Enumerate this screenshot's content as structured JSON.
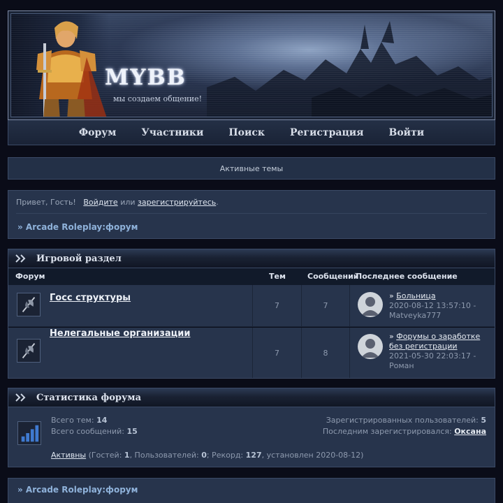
{
  "banner": {
    "title": "MYBB",
    "slogan": "мы создаем общение!"
  },
  "nav": {
    "items": [
      "Форум",
      "Участники",
      "Поиск",
      "Регистрация",
      "Войти"
    ]
  },
  "active_topics": "Активные темы",
  "welcome": {
    "greeting": "Привет, Гость!",
    "login_link": "Войдите",
    "or": "или",
    "register_link": "зарегистрируйтесь",
    "period": "."
  },
  "breadcrumb": "» Arcade Roleplay:форум",
  "game_section": {
    "title": "Игровой раздел",
    "columns": {
      "forum": "Форум",
      "topics": "Тем",
      "posts": "Сообщений",
      "last_post": "Последнее сообщение"
    },
    "forums": [
      {
        "name": "Госс структуры",
        "topics": "7",
        "posts": "7",
        "last_title": "Больница",
        "last_date": "2020-08-12 13:57:10 -",
        "last_user": "Matveyka777"
      },
      {
        "name": "Нелегальные организации",
        "topics": "7",
        "posts": "8",
        "last_title": "Форумы о заработке без регистрации",
        "last_date": "2021-05-30 22:03:17 -",
        "last_user": "Роман"
      }
    ]
  },
  "stats": {
    "title": "Статистика форума",
    "total_topics_label": "Всего тем:",
    "total_topics": "14",
    "total_posts_label": "Всего сообщений:",
    "total_posts": "15",
    "registered_label": "Зарегистрированных пользователей:",
    "registered": "5",
    "last_registered_label": "Последним зарегистрировался:",
    "last_registered": "Оксана",
    "active_link": "Активны",
    "guests_label": "(Гостей:",
    "guests": "1",
    "users_label": ", Пользователей:",
    "users": "0",
    "record_label": "; Рекорд:",
    "record": "127",
    "record_date": ", установлен 2020-08-12)"
  },
  "footer_breadcrumb": "» Arcade Roleplay:форум",
  "colors": {
    "background": "#0a0c18",
    "panel": "#27344c",
    "border": "#3b4a66",
    "link_blue": "#8fb2da"
  }
}
